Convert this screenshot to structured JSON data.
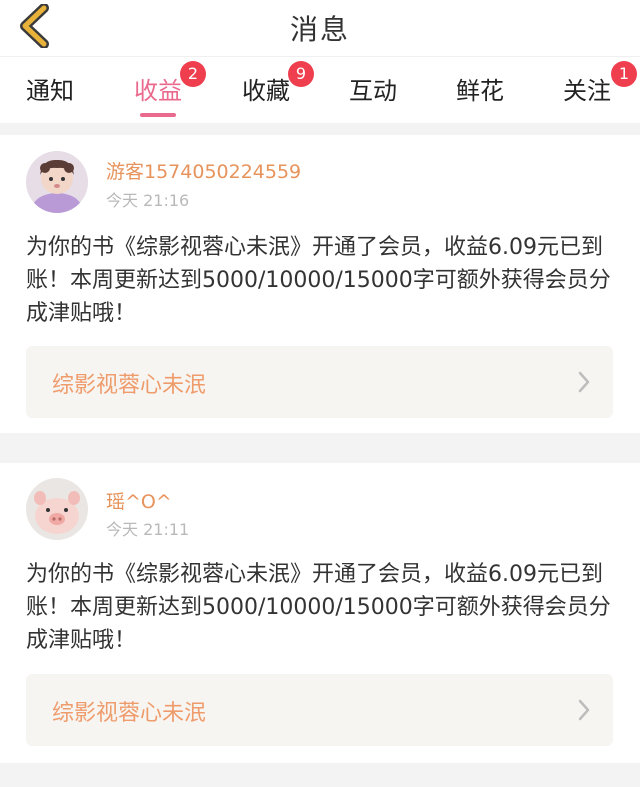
{
  "header": {
    "title": "消息"
  },
  "tabs": [
    {
      "label": "通知"
    },
    {
      "label": "收益",
      "badge": "2",
      "active": true
    },
    {
      "label": "收藏",
      "badge": "9"
    },
    {
      "label": "互动"
    },
    {
      "label": "鲜花"
    },
    {
      "label": "关注",
      "badge": "1"
    }
  ],
  "messages": [
    {
      "username": "游客1574050224559",
      "time": "今天 21:16",
      "text": "为你的书《综影视蓉心未泯》开通了会员，收益6.09元已到账！本周更新达到5000/10000/15000字可额外获得会员分成津贴哦！",
      "book_title": "综影视蓉心未泯"
    },
    {
      "username": "瑶^O^",
      "time": "今天 21:11",
      "text": "为你的书《综影视蓉心未泯》开通了会员，收益6.09元已到账！本周更新达到5000/10000/15000字可额外获得会员分成津贴哦！",
      "book_title": "综影视蓉心未泯"
    }
  ],
  "colors": {
    "accent": "#e96a8d",
    "badge": "#ef3f4f",
    "username": "#e7935c",
    "book_link": "#ef9c6c",
    "back_arrow": "#e8b23a"
  },
  "icons": {
    "back": "chevron-left-icon",
    "book_link_arrow": "chevron-right-icon"
  }
}
